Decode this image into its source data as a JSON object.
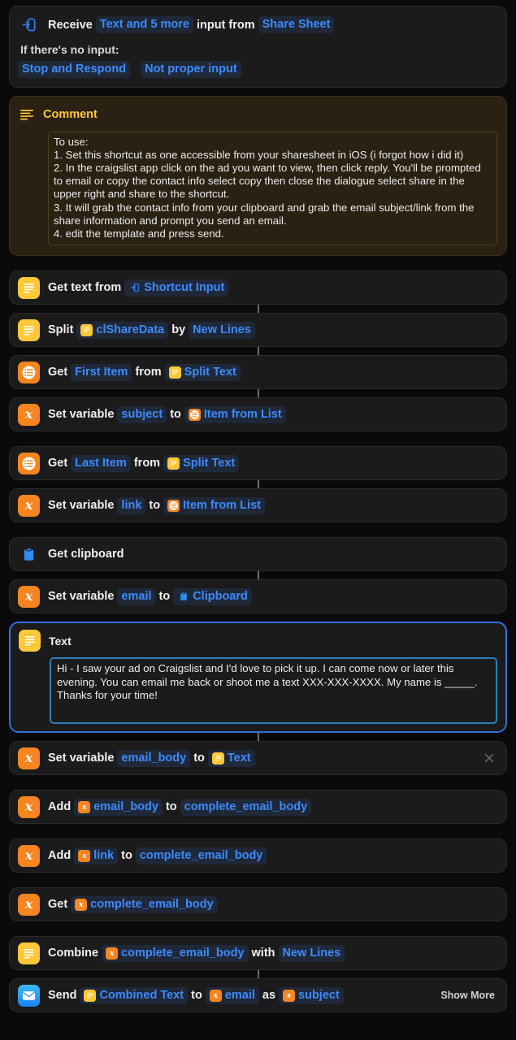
{
  "receive": {
    "icon": "shortcut-input-icon",
    "verb": "Receive",
    "input_types": "Text and 5 more",
    "middle": "input from",
    "source": "Share Sheet",
    "no_input_label": "If there's no input:",
    "no_input_action": "Stop and Respond",
    "no_input_message": "Not proper input"
  },
  "comment": {
    "icon": "comment-lines-icon",
    "title": "Comment",
    "body": "To use:\n1. Set this shortcut as one accessible from your sharesheet in iOS (i forgot how i did it)\n2. In the craigslist app click on the ad you want to view, then click reply. You'll be prompted to email or copy the contact info select copy then close the dialogue select share in the upper right and share to the shortcut.\n3. It will grab the contact info from your clipboard and grab the email subject/link from the share information and prompt you send an email.\n4. edit the template and press send."
  },
  "actions": {
    "get_text": {
      "verb": "Get text from",
      "token": "Shortcut Input",
      "token_icon": "shortcut-input-icon"
    },
    "split": {
      "verb": "Split",
      "token": "clShareData",
      "token_icon": "text-icon",
      "mid": "by",
      "separator": "New Lines"
    },
    "get_first": {
      "verb": "Get",
      "item": "First Item",
      "mid": "from",
      "token": "Split Text",
      "token_icon": "text-icon"
    },
    "set_subject": {
      "verb": "Set variable",
      "var": "subject",
      "mid": "to",
      "token": "Item from List",
      "token_icon": "list-item-icon"
    },
    "get_last": {
      "verb": "Get",
      "item": "Last Item",
      "mid": "from",
      "token": "Split Text",
      "token_icon": "text-icon"
    },
    "set_link": {
      "verb": "Set variable",
      "var": "link",
      "mid": "to",
      "token": "Item from List",
      "token_icon": "list-item-icon"
    },
    "get_clipboard": {
      "verb": "Get clipboard",
      "icon": "clipboard-icon"
    },
    "set_email": {
      "verb": "Set variable",
      "var": "email",
      "mid": "to",
      "token": "Clipboard",
      "token_icon": "clipboard-icon"
    },
    "text_block": {
      "title": "Text",
      "icon": "text-icon",
      "value": "Hi - I saw your ad on Craigslist and I'd love to pick it up.  I can come now or later this evening. You can email me back or shoot me a text XXX-XXX-XXXX. My name is _____. Thanks for your time!"
    },
    "set_email_body": {
      "verb": "Set variable",
      "var": "email_body",
      "mid": "to",
      "token": "Text",
      "token_icon": "text-icon",
      "close_icon": "close-icon"
    },
    "add_email_body": {
      "verb": "Add",
      "token": "email_body",
      "token_icon": "variable-icon",
      "mid": "to",
      "target": "complete_email_body"
    },
    "add_link": {
      "verb": "Add",
      "token": "link",
      "token_icon": "variable-icon",
      "mid": "to",
      "target": "complete_email_body"
    },
    "get_complete": {
      "verb": "Get",
      "token": "complete_email_body",
      "token_icon": "variable-icon"
    },
    "combine": {
      "verb": "Combine",
      "token": "complete_email_body",
      "token_icon": "variable-icon",
      "mid": "with",
      "separator": "New Lines"
    },
    "send_email": {
      "icon": "mail-icon",
      "verb": "Send",
      "token": "Combined Text",
      "token_icon": "text-icon",
      "mid1": "to",
      "recipient": "email",
      "recipient_icon": "variable-icon",
      "mid2": "as",
      "subject": "subject",
      "subject_icon": "variable-icon",
      "show_more": "Show More"
    }
  },
  "colors": {
    "accent_blue": "#3d8bfd",
    "comment_yellow": "#ffc93c",
    "icon_yellow": "#ffc838",
    "icon_orange": "#f7851f",
    "selection_blue": "#2f72d8",
    "background": "#0a0a0a"
  }
}
